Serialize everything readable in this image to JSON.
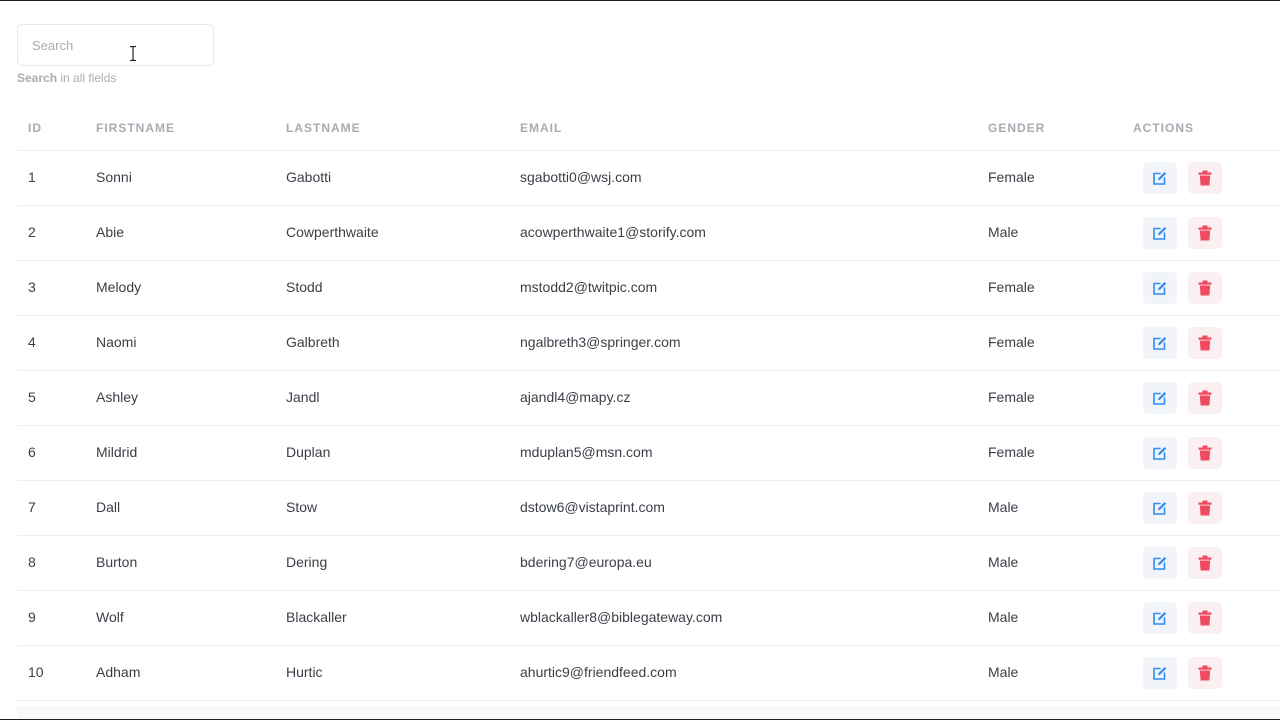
{
  "search": {
    "placeholder": "Search",
    "value": "",
    "hint_bold": "Search",
    "hint_rest": " in all fields"
  },
  "table": {
    "columns": {
      "id": "ID",
      "firstname": "FIRSTNAME",
      "lastname": "LASTNAME",
      "email": "EMAIL",
      "gender": "GENDER",
      "actions": "ACTIONS"
    },
    "rows": [
      {
        "id": "1",
        "firstname": "Sonni",
        "lastname": "Gabotti",
        "email": "sgabotti0@wsj.com",
        "gender": "Female"
      },
      {
        "id": "2",
        "firstname": "Abie",
        "lastname": "Cowperthwaite",
        "email": "acowperthwaite1@storify.com",
        "gender": "Male"
      },
      {
        "id": "3",
        "firstname": "Melody",
        "lastname": "Stodd",
        "email": "mstodd2@twitpic.com",
        "gender": "Female"
      },
      {
        "id": "4",
        "firstname": "Naomi",
        "lastname": "Galbreth",
        "email": "ngalbreth3@springer.com",
        "gender": "Female"
      },
      {
        "id": "5",
        "firstname": "Ashley",
        "lastname": "Jandl",
        "email": "ajandl4@mapy.cz",
        "gender": "Female"
      },
      {
        "id": "6",
        "firstname": "Mildrid",
        "lastname": "Duplan",
        "email": "mduplan5@msn.com",
        "gender": "Female"
      },
      {
        "id": "7",
        "firstname": "Dall",
        "lastname": "Stow",
        "email": "dstow6@vistaprint.com",
        "gender": "Male"
      },
      {
        "id": "8",
        "firstname": "Burton",
        "lastname": "Dering",
        "email": "bdering7@europa.eu",
        "gender": "Male"
      },
      {
        "id": "9",
        "firstname": "Wolf",
        "lastname": "Blackaller",
        "email": "wblackaller8@biblegateway.com",
        "gender": "Male"
      },
      {
        "id": "10",
        "firstname": "Adham",
        "lastname": "Hurtic",
        "email": "ahurtic9@friendfeed.com",
        "gender": "Male"
      }
    ]
  },
  "icons": {
    "edit": "pencil-edit-icon",
    "delete": "trash-icon"
  },
  "colors": {
    "edit_icon": "#2f8cf2",
    "delete_icon": "#ef4a5f",
    "header_text": "#a7abb3",
    "body_text": "#3a3f47"
  }
}
